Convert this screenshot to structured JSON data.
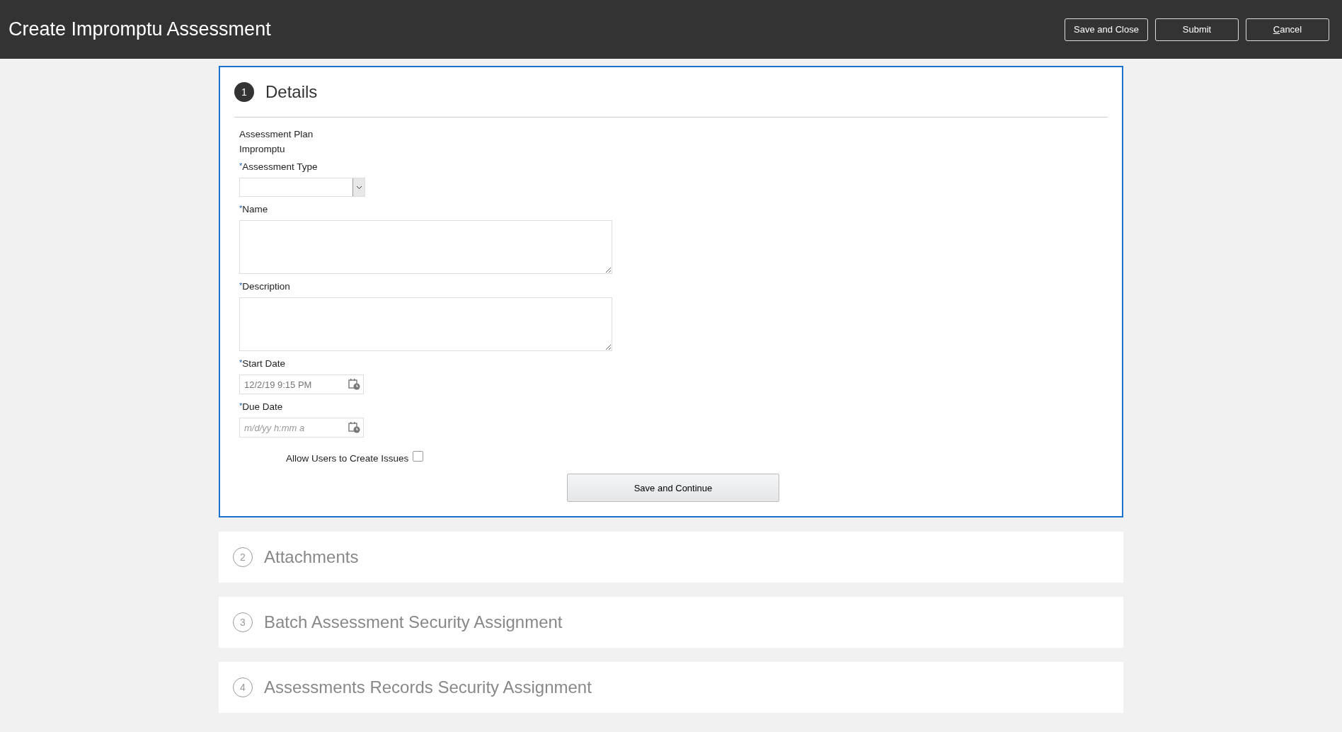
{
  "header": {
    "title": "Create Impromptu Assessment",
    "buttons": [
      {
        "label": "Save and Close",
        "mnemonic": false
      },
      {
        "label": "Submit",
        "mnemonic": false
      },
      {
        "label": "Cancel",
        "mnemonic": true
      }
    ]
  },
  "steps": [
    {
      "number": "1",
      "title": "Details",
      "expanded": true
    },
    {
      "number": "2",
      "title": "Attachments",
      "expanded": false
    },
    {
      "number": "3",
      "title": "Batch Assessment Security Assignment",
      "expanded": false
    },
    {
      "number": "4",
      "title": "Assessments Records Security Assignment",
      "expanded": false
    }
  ],
  "details": {
    "required_mark": "*",
    "plan_label": "Assessment Plan",
    "plan_value": "Impromptu",
    "fields": [
      {
        "kind": "select",
        "label": "Assessment Type",
        "required": true
      },
      {
        "kind": "text",
        "label": "Name",
        "required": true
      },
      {
        "kind": "text",
        "label": "Description",
        "required": true
      },
      {
        "kind": "datetime",
        "label": "Start Date",
        "required": true,
        "value": "12/2/19 9:15 PM"
      },
      {
        "kind": "datetime",
        "label": "Due Date",
        "required": true,
        "placeholder": "m/d/yy h:mm a"
      }
    ],
    "checkbox": {
      "label": "Allow Users to Create Issues",
      "checked": false
    },
    "button": "Save and Continue"
  }
}
